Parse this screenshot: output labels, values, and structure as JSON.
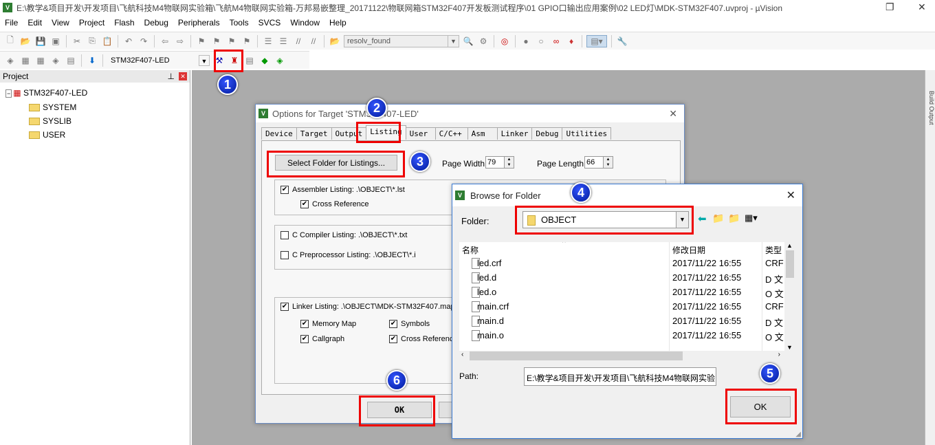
{
  "window": {
    "title": "E:\\教学&项目开发\\开发项目\\飞航科技M4物联网实验箱\\飞航M4物联网实验箱-万邦易嵌整理_20171122\\物联网箱STM32F407开发板测试程序\\01 GPIO口输出应用案例\\02 LED灯\\MDK-STM32F407.uvproj - µVision"
  },
  "menu": [
    "File",
    "Edit",
    "View",
    "Project",
    "Flash",
    "Debug",
    "Peripherals",
    "Tools",
    "SVCS",
    "Window",
    "Help"
  ],
  "toolbar": {
    "find_combo": "resolv_found",
    "target_combo": "STM32F407-LED"
  },
  "project": {
    "header": "Project",
    "root": "STM32F407-LED",
    "groups": [
      "SYSTEM",
      "SYSLIB",
      "USER"
    ]
  },
  "build_output": "Build Output",
  "options_dialog": {
    "title": "Options for Target 'STM32F407-LED'",
    "tabs": [
      "Device",
      "Target",
      "Output",
      "Listing",
      "User",
      "C/C++",
      "Asm",
      "Linker",
      "Debug",
      "Utilities"
    ],
    "active_tab": "Listing",
    "select_folder_button": "Select Folder for Listings...",
    "page_width_label": "Page Width:",
    "page_width": "79",
    "page_length_label": "Page Length:",
    "page_length": "66",
    "assembler_listing": "Assembler Listing:  .\\OBJECT\\*.lst",
    "assembler_checked": true,
    "cross_reference": "Cross Reference",
    "cross_reference_checked": true,
    "c_compiler_listing": "C Compiler Listing:  .\\OBJECT\\*.txt",
    "c_compiler_checked": false,
    "c_preprocessor_listing": "C Preprocessor Listing:  .\\OBJECT\\*.i",
    "c_preprocessor_checked": false,
    "linker_listing": "Linker Listing:  .\\OBJECT\\MDK-STM32F407.map",
    "linker_checked": true,
    "memory_map": "Memory Map",
    "symbols": "Symbols",
    "callgraph": "Callgraph",
    "linker_cross_reference": "Cross Reference",
    "ok_button": "OK"
  },
  "browse_dialog": {
    "title": "Browse for Folder",
    "folder_label": "Folder:",
    "folder_value": "OBJECT",
    "columns": [
      "名称",
      "修改日期",
      "类型"
    ],
    "files": [
      {
        "name": "led.crf",
        "date": "2017/11/22 16:55",
        "type": "CRF"
      },
      {
        "name": "led.d",
        "date": "2017/11/22 16:55",
        "type": "D 文"
      },
      {
        "name": "led.o",
        "date": "2017/11/22 16:55",
        "type": "O 文"
      },
      {
        "name": "main.crf",
        "date": "2017/11/22 16:55",
        "type": "CRF"
      },
      {
        "name": "main.d",
        "date": "2017/11/22 16:55",
        "type": "D 文"
      },
      {
        "name": "main.o",
        "date": "2017/11/22 16:55",
        "type": "O 文"
      }
    ],
    "path_label": "Path:",
    "path_value": "E:\\教学&项目开发\\开发项目\\飞航科技M4物联网实验",
    "ok_button": "OK"
  },
  "steps": [
    "1",
    "2",
    "3",
    "4",
    "5",
    "6"
  ],
  "colors": {
    "highlight": "#e00000",
    "step_badge": "#0022cc",
    "workspace": "#ababab"
  }
}
